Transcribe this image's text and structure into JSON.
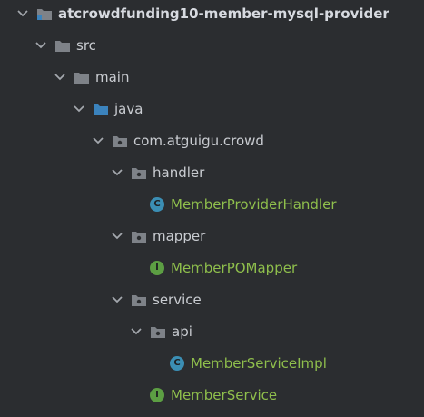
{
  "colors": {
    "background": "#2b2d30",
    "text": "#c9ccd1",
    "source_text": "#8fbf4c",
    "folder": "#7e8288",
    "source_folder": "#3b83bd",
    "class_badge": "#3b8eb4",
    "interface_badge": "#5c9e43"
  },
  "tree": {
    "project": {
      "label": "atcrowdfunding10-member-mysql-provider",
      "icon": "project-folder-icon"
    },
    "src": {
      "label": "src",
      "icon": "folder-icon"
    },
    "main": {
      "label": "main",
      "icon": "folder-icon"
    },
    "java": {
      "label": "java",
      "icon": "source-root-folder-icon"
    },
    "package": {
      "label": "com.atguigu.crowd",
      "icon": "package-icon"
    },
    "handler": {
      "label": "handler",
      "icon": "package-icon"
    },
    "member_provider_handler": {
      "label": "MemberProviderHandler",
      "badge": "C",
      "icon": "class-icon"
    },
    "mapper": {
      "label": "mapper",
      "icon": "package-icon"
    },
    "member_po_mapper": {
      "label": "MemberPOMapper",
      "badge": "I",
      "icon": "interface-icon"
    },
    "service": {
      "label": "service",
      "icon": "package-icon"
    },
    "api": {
      "label": "api",
      "icon": "package-icon"
    },
    "member_service_impl": {
      "label": "MemberServiceImpl",
      "badge": "C",
      "icon": "class-icon"
    },
    "member_service": {
      "label": "MemberService",
      "badge": "I",
      "icon": "interface-icon"
    }
  }
}
